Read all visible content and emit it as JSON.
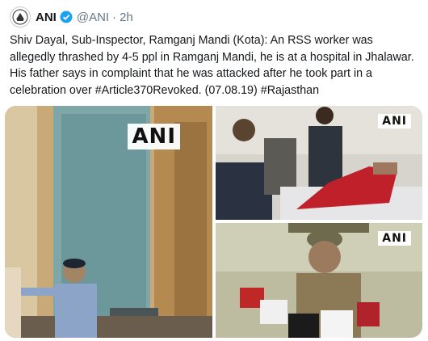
{
  "tweet": {
    "author_name": "ANI",
    "handle": "@ANI",
    "separator": "·",
    "time": "2h",
    "text": "Shiv Dayal, Sub-Inspector, Ramganj Mandi (Kota): An RSS worker was allegedly thrashed by 4-5 ppl in Ramganj Mandi, he is at a hospital in Jhalawar. His father says in complaint that he was attacked after he took part in a celebration over #Article370Revoked. (07.08.19) #Rajasthan"
  },
  "media": {
    "watermark_1": "ANI",
    "watermark_2": "ANI",
    "watermark_3": "ANI",
    "mic_label": "ANI"
  },
  "icons": {
    "avatar": "ani-logo-icon",
    "verified": "verified-badge-icon"
  },
  "colors": {
    "verified_blue": "#1da1f2",
    "handle_gray": "#657786"
  }
}
